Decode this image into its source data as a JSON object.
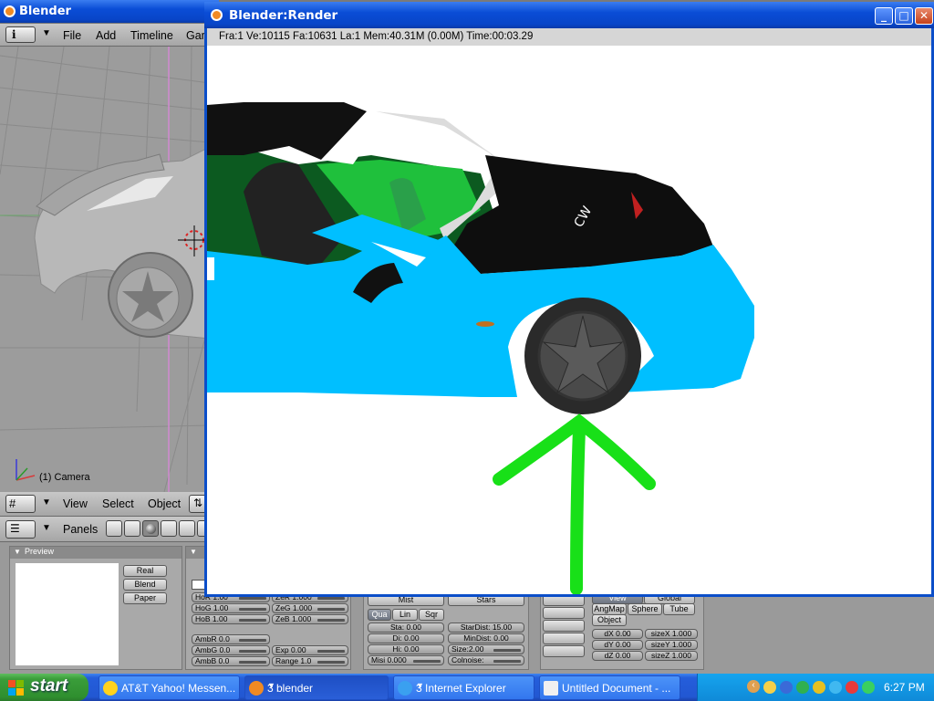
{
  "blender": {
    "title": "Blender",
    "menu": {
      "file": "File",
      "add": "Add",
      "timeline": "Timeline",
      "game": "Gar"
    },
    "viewport": {
      "label": "(1) Camera"
    },
    "view_header": {
      "view": "View",
      "select": "Select",
      "object": "Object"
    },
    "buttons_header": {
      "panels": "Panels"
    },
    "preview": {
      "title": "Preview",
      "real": "Real",
      "blend": "Blend",
      "paper": "Paper"
    },
    "world": {
      "hor": "HoR 1.00",
      "hog": "HoG 1.00",
      "hob": "HoB 1.00",
      "zer": "ZeR 1.000",
      "zeg": "ZeG 1.000",
      "zeb": "ZeB 1.000",
      "ambr": "AmbR 0.0",
      "ambg": "AmbG 0.0",
      "ambb": "AmbB 0.0",
      "exp": "Exp 0.00",
      "range": "Range 1.0"
    },
    "mist": {
      "mist": "Mist",
      "qua": "Qua",
      "lin": "Lin",
      "sqr": "Sqr",
      "sta": "Sta: 0.00",
      "di": "Di: 0.00",
      "hi": "Hi: 0.00",
      "misi": "Misi 0.000"
    },
    "stars": {
      "stars": "Stars",
      "stardist": "StarDist: 15.00",
      "mindist": "MinDist: 0.00",
      "size": "Size:2.00",
      "colnoise": "Colnoise:"
    },
    "texture": {
      "view": "View",
      "global": "Global",
      "angmap": "AngMap",
      "sphere": "Sphere",
      "tube": "Tube",
      "object": "Object",
      "dx": "dX 0.00",
      "dy": "dY 0.00",
      "dz": "dZ 0.00",
      "sizex": "sizeX 1.000",
      "sizey": "sizeY 1.000",
      "sizez": "sizeZ 1.000"
    }
  },
  "render": {
    "title": "Blender:Render",
    "info": "Fra:1  Ve:10115 Fa:10631 La:1 Mem:40.31M (0.00M) Time:00:03.29"
  },
  "taskbar": {
    "start": "start",
    "tasks": [
      {
        "label": "AT&T Yahoo! Messen..."
      },
      {
        "label": "3 blender"
      },
      {
        "label": "3 Internet Explorer"
      },
      {
        "label": "Untitled Document - ..."
      }
    ],
    "clock": "6:27 PM"
  },
  "colors": {
    "car_body": "#00bfff",
    "arrow": "#18e018",
    "accent": "#0b4ec9"
  }
}
